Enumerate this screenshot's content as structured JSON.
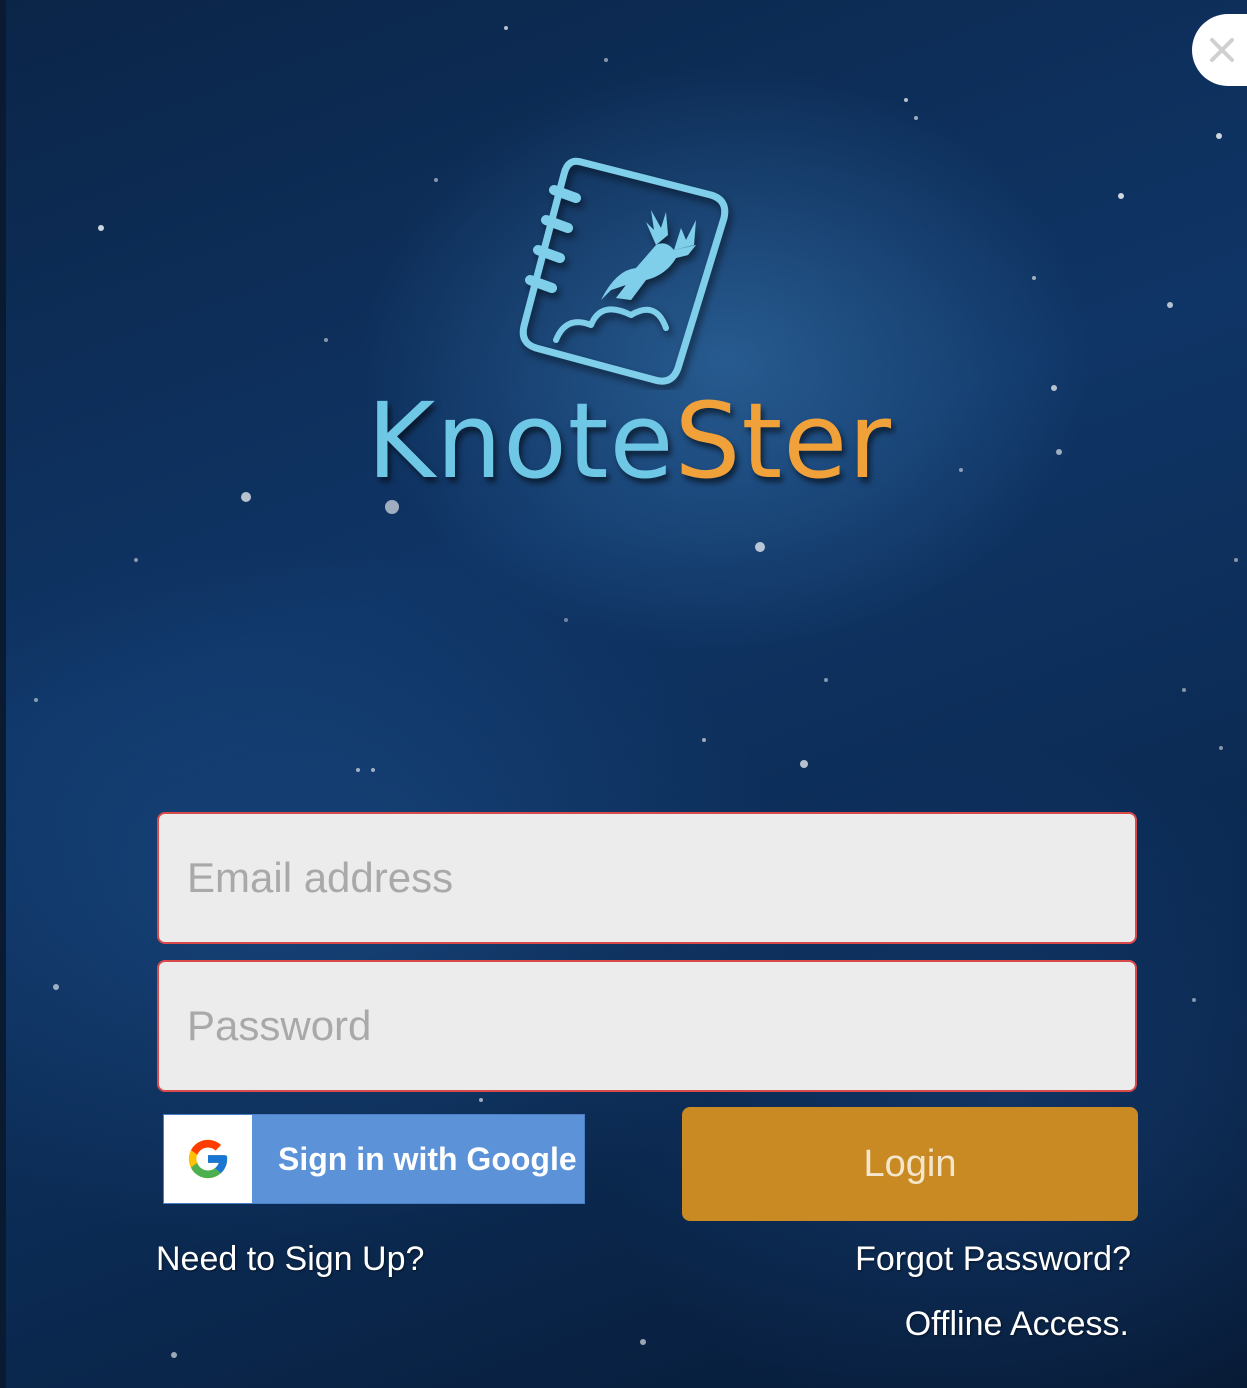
{
  "app": {
    "brand_part1": "Knote",
    "brand_part2": "Ster"
  },
  "window": {
    "close_icon": "close-icon"
  },
  "form": {
    "email_placeholder": "Email address",
    "password_placeholder": "Password",
    "google_label": "Sign in with Google",
    "login_label": "Login"
  },
  "links": {
    "signup": "Need to Sign Up?",
    "forgot": "Forgot Password?",
    "offline": "Offline Access."
  },
  "colors": {
    "brand_blue": "#6fc7e6",
    "brand_orange": "#f0a13a",
    "login_button": "#c98a24",
    "google_button": "#5b92d8",
    "field_border": "#d94a4a"
  }
}
